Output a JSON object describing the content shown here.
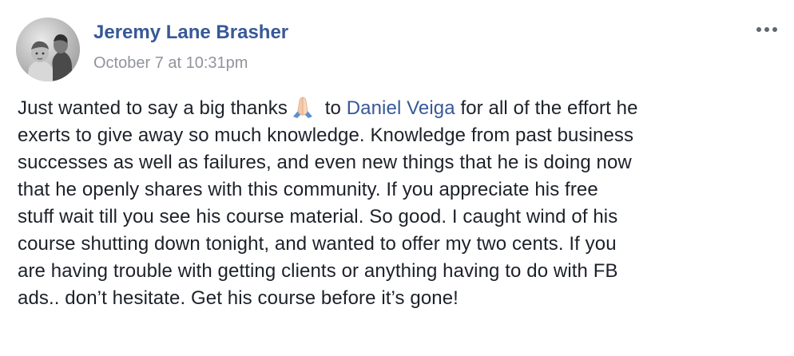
{
  "post": {
    "author_name": "Jeremy Lane Brasher",
    "timestamp": "October 7 at 10:31pm",
    "more_icon": "more-options-icon",
    "body": {
      "line1_before_emoji": "Just wanted to say a big thanks",
      "emoji": "folded-hands-icon",
      "line1_mid": " to ",
      "mention": "Daniel Veiga",
      "line1_after": " for all of the effort he",
      "line2": "exerts to give away so much knowledge. Knowledge from past business",
      "line3": "successes as well as failures, and even new things that he is doing now",
      "line4": "that he openly shares with this community. If you appreciate his free",
      "line5": "stuff wait till you see his course material. So good. I caught wind of his",
      "line6": "course shutting down tonight, and wanted to offer my two cents. If you",
      "line7": "are having trouble with getting clients or anything having to do with FB",
      "line8": "ads.. don’t hesitate. Get his course before it’s gone!"
    }
  },
  "colors": {
    "link": "#385898",
    "text": "#1d2129",
    "meta": "#90949c"
  }
}
